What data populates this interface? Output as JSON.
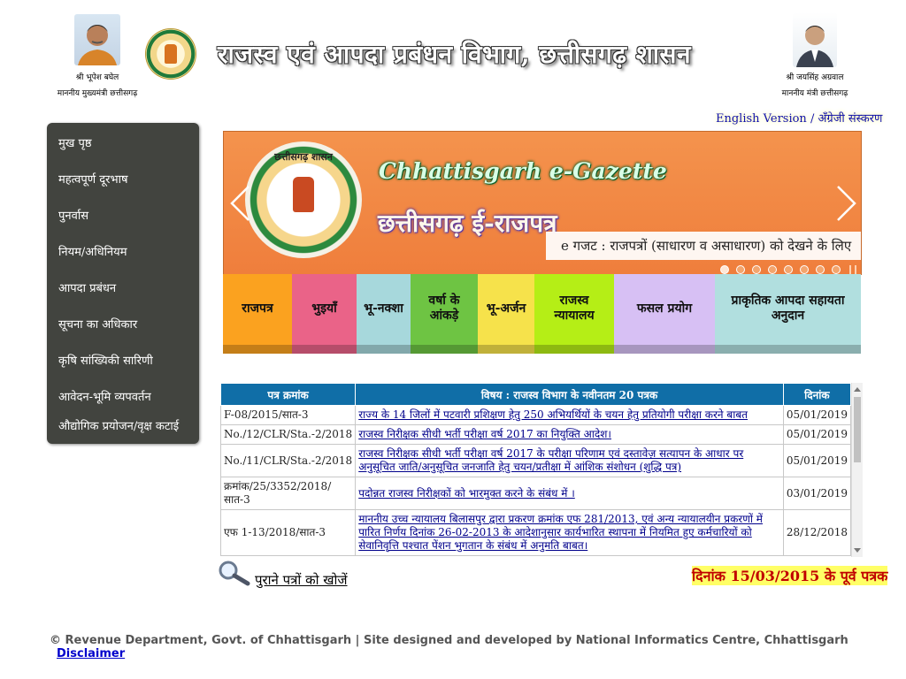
{
  "header": {
    "title": "राजस्व एवं आपदा प्रबंधन विभाग, छत्तीसगढ़ शासन",
    "left_person": {
      "name": "श्री भूपेश बघेल",
      "designation": "माननीय मुख्यमंत्री छत्तीसगढ़"
    },
    "right_person": {
      "name": "श्री जयसिंह अग्रवाल",
      "designation": "माननीय मंत्री छत्तीसगढ़"
    }
  },
  "language": {
    "english": "English Version",
    "separator": "/",
    "hindi": "अँग्रेजी संस्करण"
  },
  "sidebar": {
    "items": [
      {
        "label": "मुख पृष्ठ"
      },
      {
        "label": "महत्वपूर्ण दूरभाष"
      },
      {
        "label": "पुनर्वास"
      },
      {
        "label": "नियम/अधिनियम"
      },
      {
        "label": "आपदा प्रबंधन"
      },
      {
        "label": "सूचना का अधिकार"
      },
      {
        "label": "कृषि सांख्यिकी सारिणी"
      },
      {
        "label": "आवेदन-भूमि व्यपवर्तन"
      },
      {
        "label": "औद्योगिक प्रयोजन/वृक्ष कटाई"
      }
    ]
  },
  "slider": {
    "seal_text": "छत्तीसगढ़ शासन",
    "title_en": "Chhattisgarh e-Gazette",
    "title_hi": "छत्तीसगढ़ ई-राजपत्र",
    "caption": "e गजट : राजपत्रों (साधारण व असाधारण) को देखने के लिए",
    "dots": 8,
    "active_dot": 0
  },
  "tiles": [
    {
      "label": "राजपत्र",
      "color": "#fba21f"
    },
    {
      "label": "भुइयाँ",
      "color": "#ea6388"
    },
    {
      "label": "भू-नक्शा",
      "color": "#a7d8dc"
    },
    {
      "label": "वर्षा के आंकड़े",
      "color": "#6ec443"
    },
    {
      "label": "भू-अर्जन",
      "color": "#f6e24b"
    },
    {
      "label": "राजस्व न्यायालय",
      "color": "#b5ee16"
    },
    {
      "label": "फसल प्रयोग",
      "color": "#d7c0f4"
    },
    {
      "label": "प्राकृतिक आपदा सहायता अनुदान",
      "color": "#b1dfdf"
    }
  ],
  "table": {
    "headers": {
      "no": "पत्र क्रमांक",
      "subject": "विषय : राजस्व विभाग के नवीनतम 20 पत्रक",
      "date": "दिनांक"
    },
    "rows": [
      {
        "no": "F-08/2015/सात-3",
        "subject": "राज्य के 14 जिलों में पटवारी प्रशिक्षण हेतु 250 अभियर्थियों के चयन हेतु प्रतियोगी परीक्षा करने बाबत",
        "date": "05/01/2019"
      },
      {
        "no": "No./12/CLR/Sta.-2/2018",
        "subject": "राजस्व निरीक्षक सीधी भर्ती परीक्षा वर्ष 2017 का नियुक्ति आदेश।",
        "date": "05/01/2019"
      },
      {
        "no": "No./11/CLR/Sta.-2/2018",
        "subject": "राजस्व निरीक्षक सीधी भर्ती परीक्षा वर्ष 2017 के परीक्षा परिणाम एवं दस्तावेज़ सत्यापन के आधार पर अनुसूचित जाति/अनुसूचित जनजाति हेतु चयन/प्रतीक्षा में आंशिक संशोधन (शुद्धि पत्र)",
        "date": "05/01/2019"
      },
      {
        "no": "क्रमांक/25/3352/2018/ सात-3",
        "subject": "पदोन्नत राजस्व निरीक्षकों को भारमुक्त करने के संबंध में ।",
        "date": "03/01/2019"
      },
      {
        "no": "एफ 1-13/2018/सात-3",
        "subject": "माननीय उच्च न्यायालय बिलासपुर द्वारा प्रकरण क्रमांक एफ 281/2013, एवं अन्य न्यायालयीन प्रकरणों में पारित निर्णय दिनांक 26-02-2013 के आदेशानुसार कार्यभारित स्थापना में नियमित हुए कर्मचारियों को सेवानिवृत्ति पश्चात पेंशन भुगतान के संबंध में अनुमति बाबत।",
        "date": "28/12/2018"
      }
    ]
  },
  "old_letters": {
    "search_label": "पुराने पत्रों को खोजें",
    "pre2015_label": "दिनांक 15/03/2015 के पूर्व पत्रक"
  },
  "footer": {
    "text": "© Revenue Department, Govt. of Chhattisgarh | Site designed and developed by National Informatics Centre, Chhattisgarh",
    "disclaimer": "Disclaimer"
  }
}
